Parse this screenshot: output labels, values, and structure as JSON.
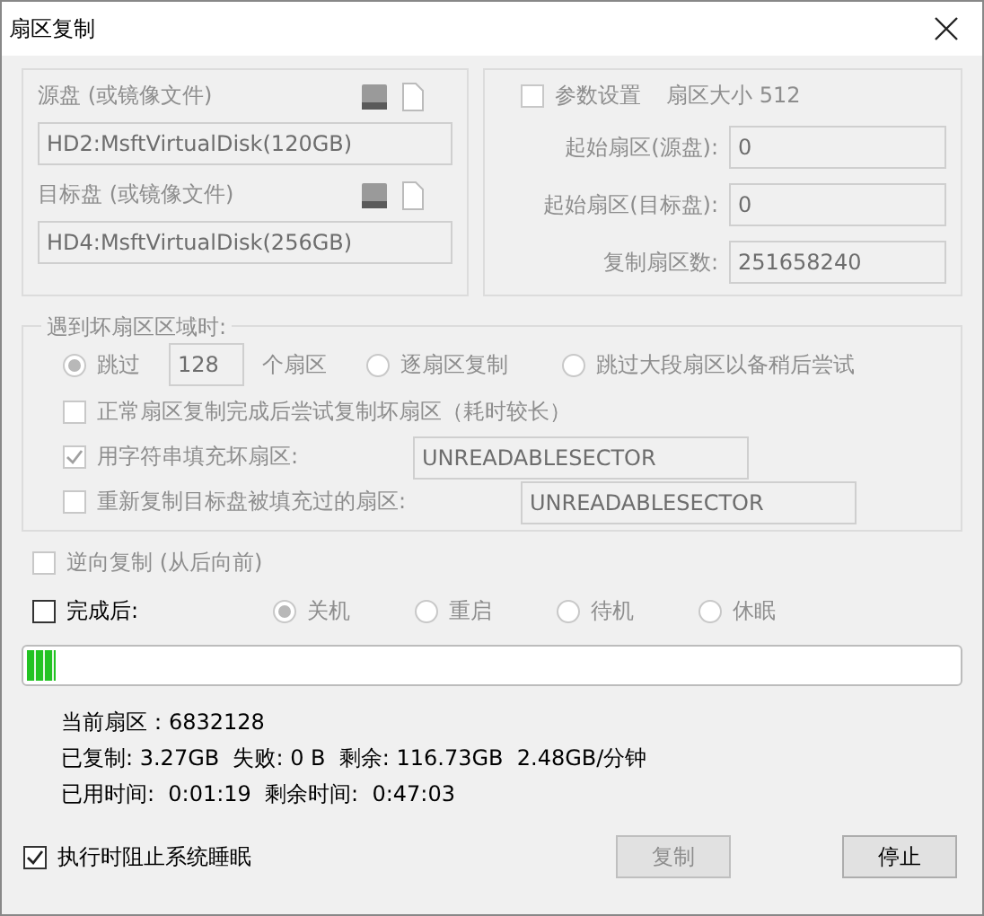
{
  "window": {
    "title": "扇区复制"
  },
  "disks": {
    "disabled": true,
    "items": [
      {
        "label": "源盘 (或镜像文件)",
        "value": "HD2:MsftVirtualDisk(120GB)"
      },
      {
        "label": "目标盘 (或镜像文件)",
        "value": "HD4:MsftVirtualDisk(256GB)"
      }
    ]
  },
  "params": {
    "disabled": true,
    "label": "参数设置",
    "checked": false,
    "sector_size": "扇区大小 512",
    "fields": [
      {
        "label": "起始扇区(源盘):",
        "value": "0"
      },
      {
        "label": "起始扇区(目标盘):",
        "value": "0"
      },
      {
        "label": "复制扇区数:",
        "value": "251658240"
      }
    ]
  },
  "bad_sectors": {
    "disabled": true,
    "title": "遇到坏扇区区域时:",
    "options": [
      {
        "label": "跳过",
        "selected": true,
        "count": "128",
        "unit": "个扇区"
      },
      {
        "label": "逐扇区复制",
        "selected": false
      },
      {
        "label": "跳过大段扇区以备稍后尝试",
        "selected": false
      }
    ],
    "checks": [
      {
        "label": "正常扇区复制完成后尝试复制坏扇区（耗时较长）",
        "checked": false
      },
      {
        "label": "用字符串填充坏扇区:",
        "checked": true,
        "value": "UNREADABLESECTOR"
      },
      {
        "label": "重新复制目标盘被填充过的扇区:",
        "checked": false,
        "value": "UNREADABLESECTOR"
      }
    ]
  },
  "reverse": {
    "label": "逆向复制 (从后向前)",
    "checked": false,
    "disabled": true
  },
  "after_done": {
    "label": "完成后:",
    "checked": false,
    "options": [
      {
        "label": "关机",
        "selected": true,
        "disabled": true
      },
      {
        "label": "重启",
        "selected": false,
        "disabled": true
      },
      {
        "label": "待机",
        "selected": false,
        "disabled": true
      },
      {
        "label": "休眠",
        "selected": false,
        "disabled": true
      }
    ]
  },
  "progress": {
    "level": 0.03
  },
  "stats": [
    "当前扇区：6832128",
    "已复制: 3.27GB  失败: 0 B  剩余: 116.73GB  2.48GB/分钟",
    "已用时间:  0:01:19  剩余时间:  0:47:03"
  ],
  "prevent_sleep": {
    "label": "执行时阻止系统睡眠",
    "checked": true
  },
  "buttons": [
    {
      "label": "复制",
      "disabled": true
    },
    {
      "label": "停止",
      "disabled": false
    }
  ]
}
